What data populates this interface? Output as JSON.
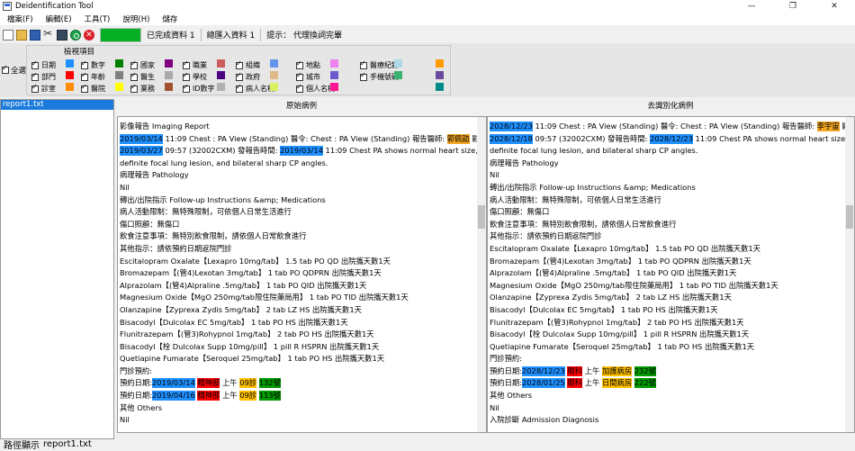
{
  "window": {
    "title": "Deidentification Tool",
    "min": "—",
    "max": "❐",
    "close": "✕"
  },
  "menu": [
    "檔案(F)",
    "編輯(E)",
    "工具(T)",
    "說明(H)",
    "儲存"
  ],
  "toolbar": {
    "progress": 1.0,
    "progress_color": "#06b025",
    "done_label": "已完成資料  1",
    "import_label": "總匯入資料  1",
    "hint_label": "提示： 代理換詞完畢",
    "stop_glyph": "✕"
  },
  "filters": {
    "group_title": "檢視項目",
    "check_all": "全選",
    "items": [
      {
        "label": "日期",
        "color": "#1e90ff"
      },
      {
        "label": "數字",
        "color": "#008000"
      },
      {
        "label": "國家",
        "color": "#800080"
      },
      {
        "label": "職業",
        "color": "#cd5c5c"
      },
      {
        "label": "組織",
        "color": "#6495ed"
      },
      {
        "label": "地點",
        "color": "#ee82ee"
      },
      {
        "label": "醫療紀錄",
        "color": "#add8e6"
      },
      {
        "label": "部門",
        "color": "#ff0000"
      },
      {
        "label": "年齡",
        "color": "#808080"
      },
      {
        "label": "醫生",
        "color": "#a9a9a9"
      },
      {
        "label": "學校",
        "color": "#4b0082"
      },
      {
        "label": "政府",
        "color": "#deb887"
      },
      {
        "label": "城市",
        "color": "#6a5acd"
      },
      {
        "label": "手機號碼",
        "color": "#3cb371"
      },
      {
        "label": "診室",
        "color": "#ff8c00"
      },
      {
        "label": "醫院",
        "color": "#ffff00"
      },
      {
        "label": "業務",
        "color": "#a0522d"
      },
      {
        "label": "ID數字",
        "color": "#b0b0b0"
      },
      {
        "label": "病人名稱",
        "color": "#d9f060"
      },
      {
        "label": "個人名稱",
        "color": "#ff1493"
      }
    ],
    "extra_colors": [
      "#ff9b00",
      "#6a4c9c",
      "#008b8b"
    ]
  },
  "panes": {
    "original_title": "原始病例",
    "deid_title": "去識別化病例"
  },
  "files": [
    "report1.txt"
  ],
  "status": {
    "label": "路徑顯示",
    "path": "report1.txt"
  },
  "colors": {
    "date": "#1e90ff",
    "doctor": "#f5a623",
    "dept": "#ff0000",
    "time": "#ffc000",
    "clinic": "#009900"
  },
  "original_lines": [
    [
      {
        "t": "影像報告 Imaging Report"
      }
    ],
    [
      {
        "t": "2019/03/14",
        "c": "date"
      },
      {
        "t": " 11:09 Chest : PA View (Standing) 醫令: Chest : PA View (Standing) 報告醫師: "
      },
      {
        "t": "郭佩劭",
        "c": "doctor"
      },
      {
        "t": " 影像時間:"
      }
    ],
    [
      {
        "t": "2019/03/27",
        "c": "date"
      },
      {
        "t": " 09:57 (32002CXM) 發報告時間: "
      },
      {
        "t": "2019/03/14",
        "c": "date"
      },
      {
        "t": " 11:09 Chest PA shows normal heart size, no"
      }
    ],
    [
      {
        "t": "definite focal lung lesion, and bilateral sharp CP angles."
      }
    ],
    [
      {
        "t": "病理報告 Pathology"
      }
    ],
    [
      {
        "t": "Nil"
      }
    ],
    [
      {
        "t": "轉出/出院指示 Follow-up Instructions &amp; Medications"
      }
    ],
    [
      {
        "t": "病人活動限制：無特殊限制，可依個人日常生活進行"
      }
    ],
    [
      {
        "t": "傷口照顧：無傷口"
      }
    ],
    [
      {
        "t": "飲食注意事項：無特別飲食限制，請依個人日常飲食進行"
      }
    ],
    [
      {
        "t": "其他指示：請依預約日期返院門診"
      }
    ],
    [
      {
        "t": "Escitalopram Oxalate【Lexapro 10mg/tab】 1.5 tab PO QD  出院攜天數1天"
      }
    ],
    [
      {
        "t": "Bromazepam【(管4)Lexotan 3mg/tab】 1 tab PO QDPRN  出院攜天數1天"
      }
    ],
    [
      {
        "t": "Alprazolam【(管4)Alpraline .5mg/tab】 1 tab PO QID  出院攜天數1天"
      }
    ],
    [
      {
        "t": "Magnesium Oxide【MgO 250mg/tab限住院藥局用】 1 tab PO TID  出院攜天數1天"
      }
    ],
    [
      {
        "t": "Olanzapine【Zyprexa Zydis 5mg/tab】 2 tab LZ HS  出院攜天數1天"
      }
    ],
    [
      {
        "t": "Bisacodyl【Dulcolax EC 5mg/tab】 1 tab PO HS  出院攜天數1天"
      }
    ],
    [
      {
        "t": "Flunitrazepam【(管3)Rohypnol 1mg/tab】 2 tab PO HS  出院攜天數1天"
      }
    ],
    [
      {
        "t": "Bisacodyl【栓 Dulcolax Supp 10mg/pill】 1 pill R HSPRN  出院攜天數1天"
      }
    ],
    [
      {
        "t": "Quetiapine Fumarate【Seroquel 25mg/tab】 1 tab PO HS  出院攜天數1天"
      }
    ],
    [
      {
        "t": "門診預約:"
      }
    ],
    [
      {
        "t": "預約日期:"
      },
      {
        "t": "2019/03/14",
        "c": "date"
      },
      {
        "t": " "
      },
      {
        "t": "精神部",
        "c": "dept"
      },
      {
        "t": " 上午 "
      },
      {
        "t": "09診",
        "c": "time"
      },
      {
        "t": " "
      },
      {
        "t": "132號",
        "c": "clinic"
      }
    ],
    [
      {
        "t": "預約日期:"
      },
      {
        "t": "2019/04/16",
        "c": "date"
      },
      {
        "t": " "
      },
      {
        "t": "精神部",
        "c": "dept"
      },
      {
        "t": " 上午 "
      },
      {
        "t": "09診",
        "c": "time"
      },
      {
        "t": " "
      },
      {
        "t": "113號",
        "c": "clinic"
      }
    ],
    [
      {
        "t": "其他 Others"
      }
    ],
    [
      {
        "t": "Nil"
      }
    ]
  ],
  "deid_lines": [
    [
      {
        "t": "2028/12/23",
        "c": "date"
      },
      {
        "t": " 11:09 Chest : PA View (Standing) 醫令: Chest : PA View (Standing) 報告醫師: "
      },
      {
        "t": "李宇宙",
        "c": "doctor"
      },
      {
        "t": " 影像時間:"
      }
    ],
    [
      {
        "t": "2028/12/18",
        "c": "date"
      },
      {
        "t": " 09:57 (32002CXM) 發報告時間: "
      },
      {
        "t": "2028/12/23",
        "c": "date"
      },
      {
        "t": " 11:09 Chest PA shows normal heart size, no"
      }
    ],
    [
      {
        "t": "definite focal lung lesion, and bilateral sharp CP angles."
      }
    ],
    [
      {
        "t": "病理報告 Pathology"
      }
    ],
    [
      {
        "t": "Nil"
      }
    ],
    [
      {
        "t": "轉出/出院指示 Follow-up Instructions &amp; Medications"
      }
    ],
    [
      {
        "t": "病人活動限制：無特殊限制，可依個人日常生活進行"
      }
    ],
    [
      {
        "t": "傷口照顧：無傷口"
      }
    ],
    [
      {
        "t": "飲食注意事項：無特別飲食限制，請依個人日常飲食進行"
      }
    ],
    [
      {
        "t": "其他指示：請依預約日期返院門診"
      }
    ],
    [
      {
        "t": "Escitalopram Oxalate【Lexapro 10mg/tab】 1.5 tab PO QD  出院攜天數1天"
      }
    ],
    [
      {
        "t": "Bromazepam【(管4)Lexotan 3mg/tab】 1 tab PO QDPRN  出院攜天數1天"
      }
    ],
    [
      {
        "t": "Alprazolam【(管4)Alpraline .5mg/tab】 1 tab PO QID  出院攜天數1天"
      }
    ],
    [
      {
        "t": "Magnesium Oxide【MgO 250mg/tab限住院藥局用】 1 tab PO TID  出院攜天數1天"
      }
    ],
    [
      {
        "t": "Olanzapine【Zyprexa Zydis 5mg/tab】 2 tab LZ HS  出院攜天數1天"
      }
    ],
    [
      {
        "t": "Bisacodyl【Dulcolax EC 5mg/tab】 1 tab PO HS  出院攜天數1天"
      }
    ],
    [
      {
        "t": "Flunitrazepam【(管3)Rohypnol 1mg/tab】 2 tab PO HS  出院攜天數1天"
      }
    ],
    [
      {
        "t": "Bisacodyl【栓 Dulcolax Supp 10mg/pill】 1 pill R HSPRN  出院攜天數1天"
      }
    ],
    [
      {
        "t": "Quetiapine Fumarate【Seroquel 25mg/tab】 1 tab PO HS  出院攜天數1天"
      }
    ],
    [
      {
        "t": "門診預約:"
      }
    ],
    [
      {
        "t": "預約日期:"
      },
      {
        "t": "2028/12/23",
        "c": "date"
      },
      {
        "t": " "
      },
      {
        "t": "眼科",
        "c": "dept"
      },
      {
        "t": " 上午 "
      },
      {
        "t": "加護病房",
        "c": "time"
      },
      {
        "t": " "
      },
      {
        "t": "232號",
        "c": "clinic"
      }
    ],
    [
      {
        "t": "預約日期:"
      },
      {
        "t": "2028/01/25",
        "c": "date"
      },
      {
        "t": " "
      },
      {
        "t": "眼科",
        "c": "dept"
      },
      {
        "t": " 上午 "
      },
      {
        "t": "日間病房",
        "c": "time"
      },
      {
        "t": " "
      },
      {
        "t": "222號",
        "c": "clinic"
      }
    ],
    [
      {
        "t": "其他 Others"
      }
    ],
    [
      {
        "t": "Nil"
      }
    ],
    [
      {
        "t": "入院診斷 Admission Diagnosis"
      }
    ]
  ]
}
